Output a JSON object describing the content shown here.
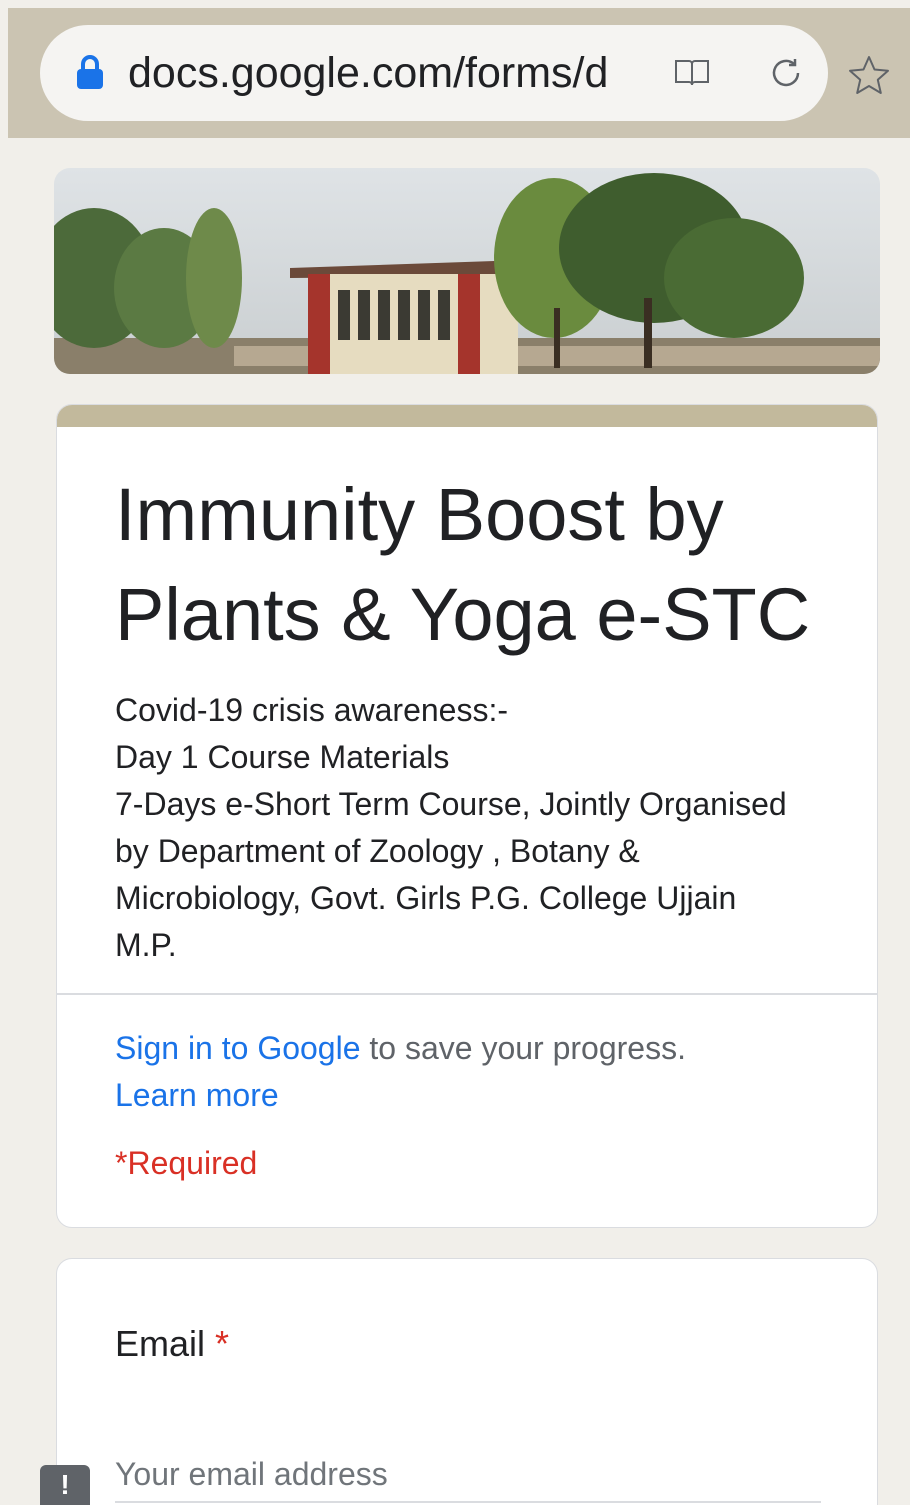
{
  "browser": {
    "url": "docs.google.com/forms/d",
    "icons": [
      "lock-icon",
      "reader-mode-icon",
      "reload-icon",
      "star-icon"
    ]
  },
  "form": {
    "title": "Immunity Boost by Plants & Yoga e-STC",
    "description_lines": [
      "Covid-19 crisis awareness:-",
      "Day 1  Course Materials",
      "7-Days e-Short Term Course, Jointly Organised",
      "by Department of Zoology , Botany &",
      "Microbiology, Govt. Girls P.G. College Ujjain",
      "M.P."
    ],
    "signin_link": "Sign in to Google",
    "signin_rest": " to save your progress.",
    "learn_more": "Learn more",
    "required_note": "*Required"
  },
  "email_question": {
    "label": "Email",
    "required_marker": "*",
    "placeholder": "Your email address"
  },
  "feedback": {
    "label": "!"
  },
  "colors": {
    "browser_bar": "#cbc4b2",
    "accent": "#c2b99c",
    "link": "#1a73e8",
    "required": "#d93025",
    "background": "#f1efea"
  }
}
